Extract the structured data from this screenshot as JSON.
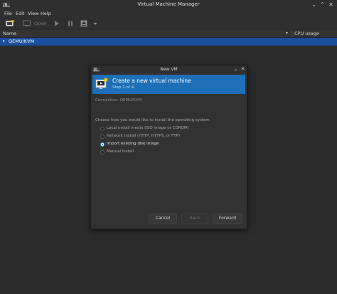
{
  "window": {
    "title": "Virtual Machine Manager",
    "minimize": "⌄",
    "maximize": "⌃",
    "close": "✕"
  },
  "menubar": {
    "items": [
      "File",
      "Edit",
      "View",
      "Help"
    ]
  },
  "toolbar": {
    "open_label": "Open"
  },
  "table": {
    "headers": {
      "name": "Name",
      "cpu": "CPU usage",
      "sort_indicator": "▾"
    },
    "rows": [
      {
        "label": "QEMU/KVM",
        "expander": "▸",
        "selected": true
      }
    ]
  },
  "dialog": {
    "title": "New VM",
    "minimize": "⌄",
    "close": "✕",
    "banner": {
      "title": "Create a new virtual machine",
      "step": "Step 1 of 4"
    },
    "connection": "Connection: QEMU/KVM",
    "prompt": "Choose how you would like to install the operating system",
    "options": [
      {
        "label": "Local install media (ISO image or CDROM)",
        "selected": false
      },
      {
        "label": "Network Install (HTTP, HTTPS, or FTP)",
        "selected": false
      },
      {
        "label": "Import existing disk image",
        "selected": true
      },
      {
        "label": "Manual install",
        "selected": false
      }
    ],
    "buttons": {
      "cancel": "Cancel",
      "back": "Back",
      "forward": "Forward"
    }
  },
  "colors": {
    "accent": "#1e6fb8",
    "selection": "#1c4f9b",
    "background": "#2b2b2b"
  }
}
